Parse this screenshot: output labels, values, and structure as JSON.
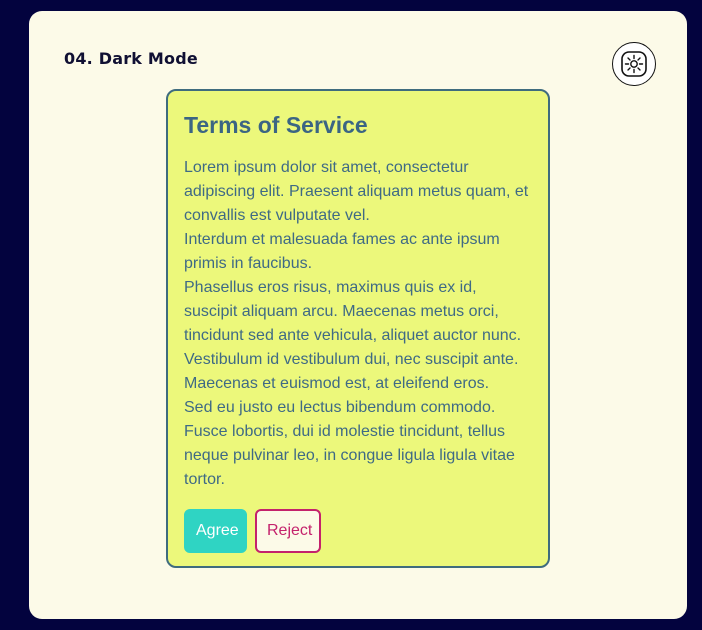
{
  "header": {
    "title": "04. Dark Mode",
    "toggle_icon": "brightness-icon"
  },
  "card": {
    "title": "Terms of Service",
    "paragraphs": [
      "Lorem ipsum dolor sit amet, consectetur adipiscing elit. Praesent aliquam metus quam, et convallis est vulputate vel.",
      "Interdum et malesuada fames ac ante ipsum primis in faucibus.",
      "Phasellus eros risus, maximus quis ex id, suscipit aliquam arcu. Maecenas metus orci, tincidunt sed ante vehicula, aliquet auctor nunc.",
      "Vestibulum id vestibulum dui, nec suscipit ante.",
      "Maecenas et euismod est, at eleifend eros.",
      "Sed eu justo eu lectus bibendum commodo.",
      "Fusce lobortis, dui id molestie tincidunt, tellus neque pulvinar leo, in congue ligula ligula vitae tortor."
    ],
    "agree_label": "Agree",
    "reject_label": "Reject"
  },
  "colors": {
    "page_background": "#03033e",
    "frame_background": "#fcfae8",
    "card_background": "#ecf87b",
    "card_border": "#3f6c7e",
    "text": "#3b6583",
    "agree": "#2fd4c3",
    "reject": "#c4226c"
  }
}
